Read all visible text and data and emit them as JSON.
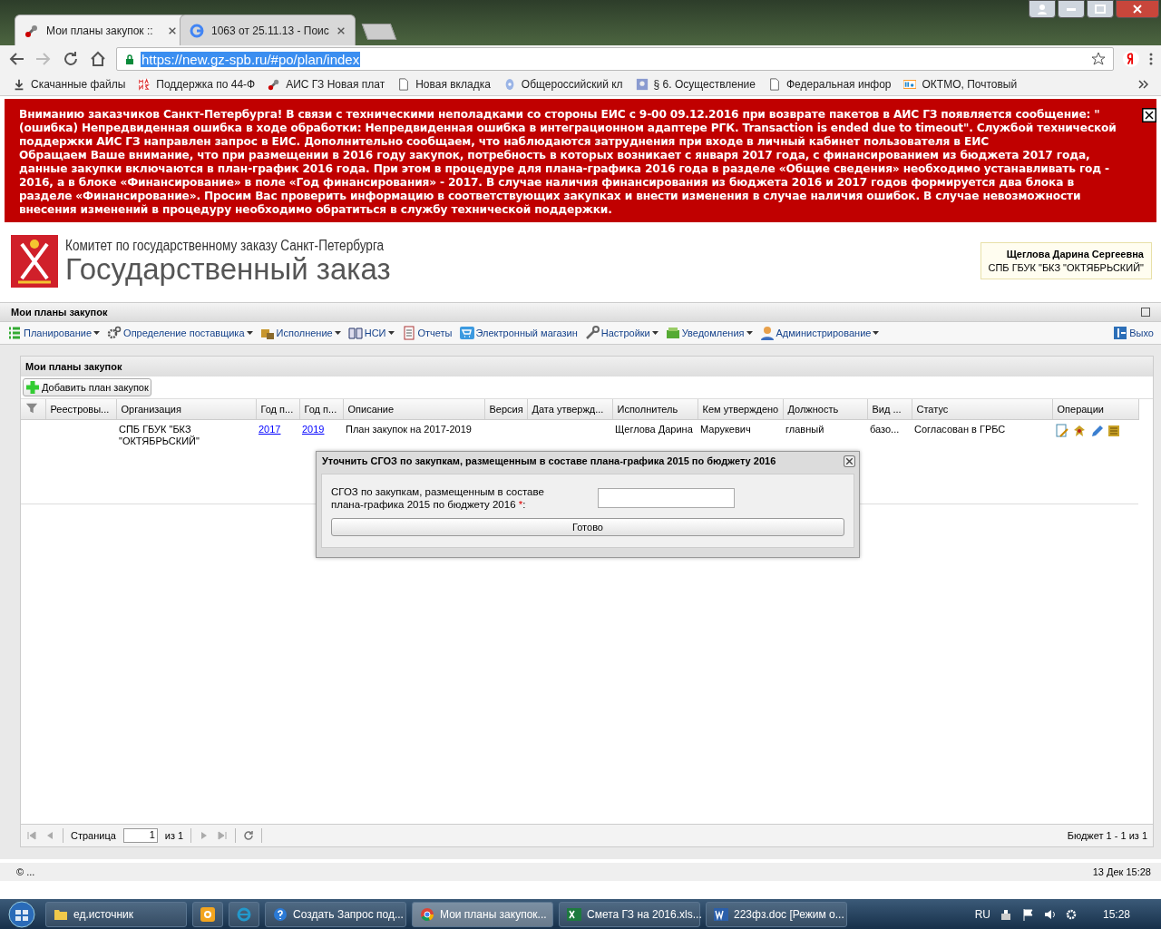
{
  "browser": {
    "tabs": [
      {
        "title": "Мои планы закупок ::",
        "selected": true
      },
      {
        "title": "1063 от 25.11.13 - Поис",
        "selected": false
      }
    ],
    "address": "https://new.gz-spb.ru/#po/plan/index",
    "bookmarks": [
      "Скачанные файлы",
      "Поддержка по 44-Ф",
      "АИС ГЗ Новая плат",
      "Новая вкладка",
      "Общероссийский кл",
      "§ 6. Осуществление",
      "Федеральная инфор",
      "ОКТМО, Почтовый"
    ]
  },
  "banner": {
    "paragraphs": [
      "Вниманию заказчиков Санкт-Петербурга! В связи с техническими неполадками со стороны ЕИС с 9-00 09.12.2016 при возврате пакетов в АИС ГЗ появляется сообщение: \"(ошибка) Непредвиденная ошибка в ходе обработки: Непредвиденная ошибка в интеграционном адаптере РГК. Transaction is ended due to timeout\". Службой технической поддержки АИС ГЗ направлен запрос в ЕИС. Дополнительно сообщаем, что наблюдаются затруднения при входе в личный кабинет пользователя в ЕИС",
      "Обращаем Ваше внимание, что при размещении в 2016 году закупок, потребность в которых возникает с января 2017 года, с финансированием из бюджета 2017 года, данные закупки включаются в план-график 2016 года. При этом в процедуре для плана-графика 2016 года в разделе «Общие сведения» необходимо устанавливать год - 2016, а в блоке «Финансирование» в поле «Год финансирования» - 2017. В случае наличия финансирования из бюджета 2016 и 2017 годов формируется два блока в разделе «Финансирование». Просим Вас проверить информацию в соответствующих закупках и внести изменения в случае наличия ошибок. В случае невозможности внесения изменений в процедуру необходимо обратиться в службу технической поддержки."
    ]
  },
  "header": {
    "subtitle": "Комитет по государственному заказу Санкт-Петербурга",
    "title": "Государственный заказ",
    "user_name": "Щеглова Дарина Сергеевна",
    "user_org": "СПБ ГБУК \"БКЗ \"ОКТЯБРЬСКИЙ\""
  },
  "app": {
    "panel_title": "Мои планы закупок",
    "menu": [
      {
        "label": "Планирование",
        "dropdown": true
      },
      {
        "label": "Определение поставщика",
        "dropdown": true
      },
      {
        "label": "Исполнение",
        "dropdown": true
      },
      {
        "label": "НСИ",
        "dropdown": true
      },
      {
        "label": "Отчеты",
        "dropdown": false
      },
      {
        "label": "Электронный магазин",
        "dropdown": false
      },
      {
        "label": "Настройки",
        "dropdown": true
      },
      {
        "label": "Уведомления",
        "dropdown": true
      },
      {
        "label": "Администрирование",
        "dropdown": true
      }
    ],
    "exit": "Выхо"
  },
  "grid": {
    "title": "Мои планы закупок",
    "add_button": "Добавить план закупок",
    "columns": [
      "Реестровы...",
      "Организация",
      "Год п...",
      "Год п...",
      "Описание",
      "Версия",
      "Дата утвержд...",
      "Исполнитель",
      "Кем утверждено",
      "Должность",
      "Вид ...",
      "Статус",
      "Операции"
    ],
    "rows": [
      {
        "cells": [
          {
            "text": ""
          },
          {
            "text": "СПБ ГБУК \"БКЗ \"ОКТЯБРЬСКИЙ\""
          },
          {
            "text": "2017",
            "link": true
          },
          {
            "text": "2019",
            "link": true
          },
          {
            "text": "План закупок на 2017-2019"
          },
          {
            "text": ""
          },
          {
            "text": ""
          },
          {
            "text": "Щеглова Дарина"
          },
          {
            "text": "Марукевич"
          },
          {
            "text": "главный"
          },
          {
            "text": "базо..."
          },
          {
            "text": "Согласован в ГРБС"
          }
        ]
      }
    ],
    "pager": {
      "page_label": "Страница",
      "page": "1",
      "of": "из 1",
      "summary": "Бюджет 1 - 1 из 1"
    }
  },
  "dialog": {
    "title": "Уточнить СГОЗ по закупкам, размещенным в составе плана-графика 2015 по бюджету 2016",
    "label": "СГОЗ по закупкам, размещенным в составе плана-графика 2015 по бюджету 2016",
    "required": "*",
    "suffix": ":",
    "button": "Готово"
  },
  "footer": {
    "left": "© ...",
    "right": "13 Дек 15:28"
  },
  "taskbar": {
    "items": [
      {
        "label": "ед.источник",
        "active": false
      },
      {
        "active": false
      },
      {
        "active": false
      },
      {
        "label": "Создать Запрос под...",
        "active": false
      },
      {
        "label": "Мои планы закупок...",
        "active": true
      },
      {
        "label": "Смета ГЗ на 2016.xls...",
        "active": false
      },
      {
        "label": "223фз.doc [Режим о...",
        "active": false
      }
    ],
    "lang": "RU",
    "clock": "15:28"
  }
}
